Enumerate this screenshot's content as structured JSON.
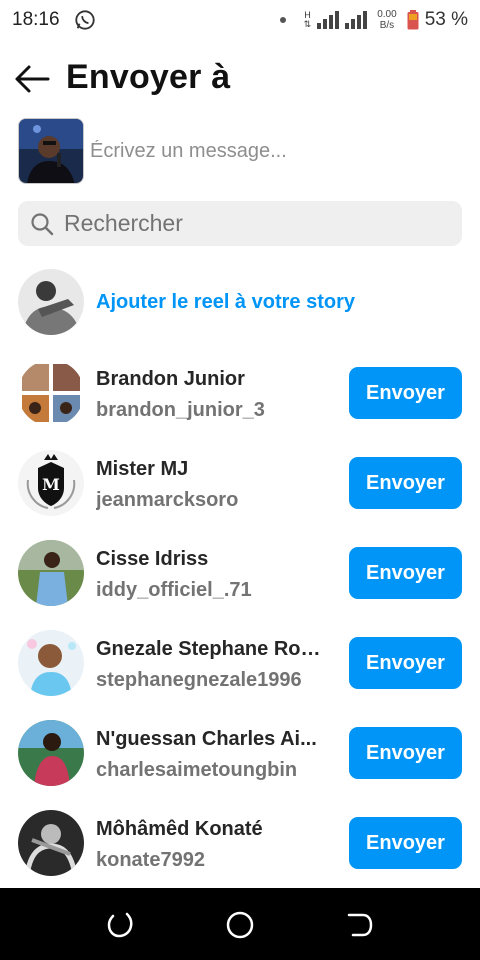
{
  "status_bar": {
    "time": "18:16",
    "network_h": "H",
    "network_speed_value": "0.00",
    "network_speed_unit": "B/s",
    "battery_percent": "53 %"
  },
  "header": {
    "title": "Envoyer à"
  },
  "compose": {
    "placeholder": "Écrivez un message..."
  },
  "search": {
    "placeholder": "Rechercher"
  },
  "story": {
    "label": "Ajouter le reel à votre story"
  },
  "contacts": [
    {
      "name": "Brandon Junior",
      "username": "brandon_junior_3",
      "button": "Envoyer"
    },
    {
      "name": "Mister MJ",
      "username": "jeanmarcksoro",
      "button": "Envoyer"
    },
    {
      "name": "Cisse Idriss",
      "username": "iddy_officiel_.71",
      "button": "Envoyer"
    },
    {
      "name": "Gnezale Stephane Rod...",
      "username": "stephanegnezale1996",
      "button": "Envoyer"
    },
    {
      "name": "N'guessan Charles Ai...",
      "username": "charlesaimetoungbin",
      "button": "Envoyer"
    },
    {
      "name": "Môhâmêd Konaté",
      "username": "konate7992",
      "button": "Envoyer"
    }
  ],
  "colors": {
    "accent": "#0095f6",
    "search_bg": "#efefef",
    "nav_bar": "#000000"
  },
  "icons": {
    "back": "arrow-left-icon",
    "search": "search-icon",
    "whatsapp": "whatsapp-icon",
    "nav_recent": "recent-apps-icon",
    "nav_home": "home-circle-icon",
    "nav_back": "back-nav-icon"
  }
}
